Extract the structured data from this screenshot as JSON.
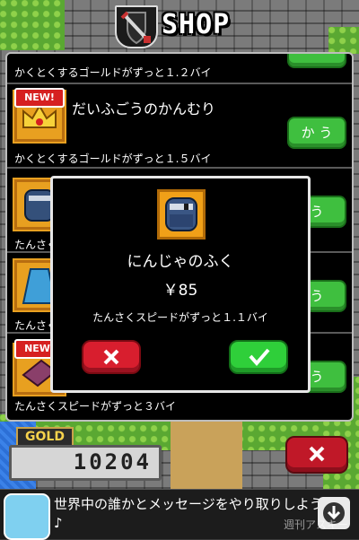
{
  "header": {
    "title": "SHOP"
  },
  "shop": {
    "items": [
      {
        "desc": "かくとくするゴールドがずっと１.２バイ",
        "name": "",
        "new": "",
        "buy_label": ""
      },
      {
        "desc": "かくとくするゴールドがずっと１.５バイ",
        "name": "だいふごうのかんむり",
        "new": "NEW!",
        "buy_label": "か う"
      },
      {
        "desc": "たんさく",
        "name": "",
        "new": "",
        "buy_label": "う"
      },
      {
        "desc": "たんさく",
        "name": "",
        "new": "",
        "buy_label": "う"
      },
      {
        "desc": "たんさくスピードがずっと３バイ",
        "name": "",
        "new": "NEW!",
        "buy_label": "う"
      }
    ]
  },
  "modal": {
    "item_name": "にんじゃのふく",
    "price": "￥85",
    "desc": "たんさくスピードがずっと１.１バイ",
    "cancel_symbol": "✕",
    "confirm_symbol": "✓"
  },
  "gold": {
    "label": "GOLD",
    "value": "10204"
  },
  "close": {
    "symbol": "✕"
  },
  "ad": {
    "text": "世界中の誰かとメッセージをやり取りしよう♪",
    "credit": "週刊アスキー"
  },
  "icons": {
    "emblem": "sword-shield-icon",
    "crown": "crown-icon",
    "ninja": "ninja-outfit-icon",
    "cape": "cape-icon",
    "book": "book-icon",
    "download": "download-icon"
  },
  "colors": {
    "buy": "#3fbf3f",
    "cancel": "#d81e2e",
    "confirm": "#2fcf3a",
    "gold": "#f6d24c"
  }
}
